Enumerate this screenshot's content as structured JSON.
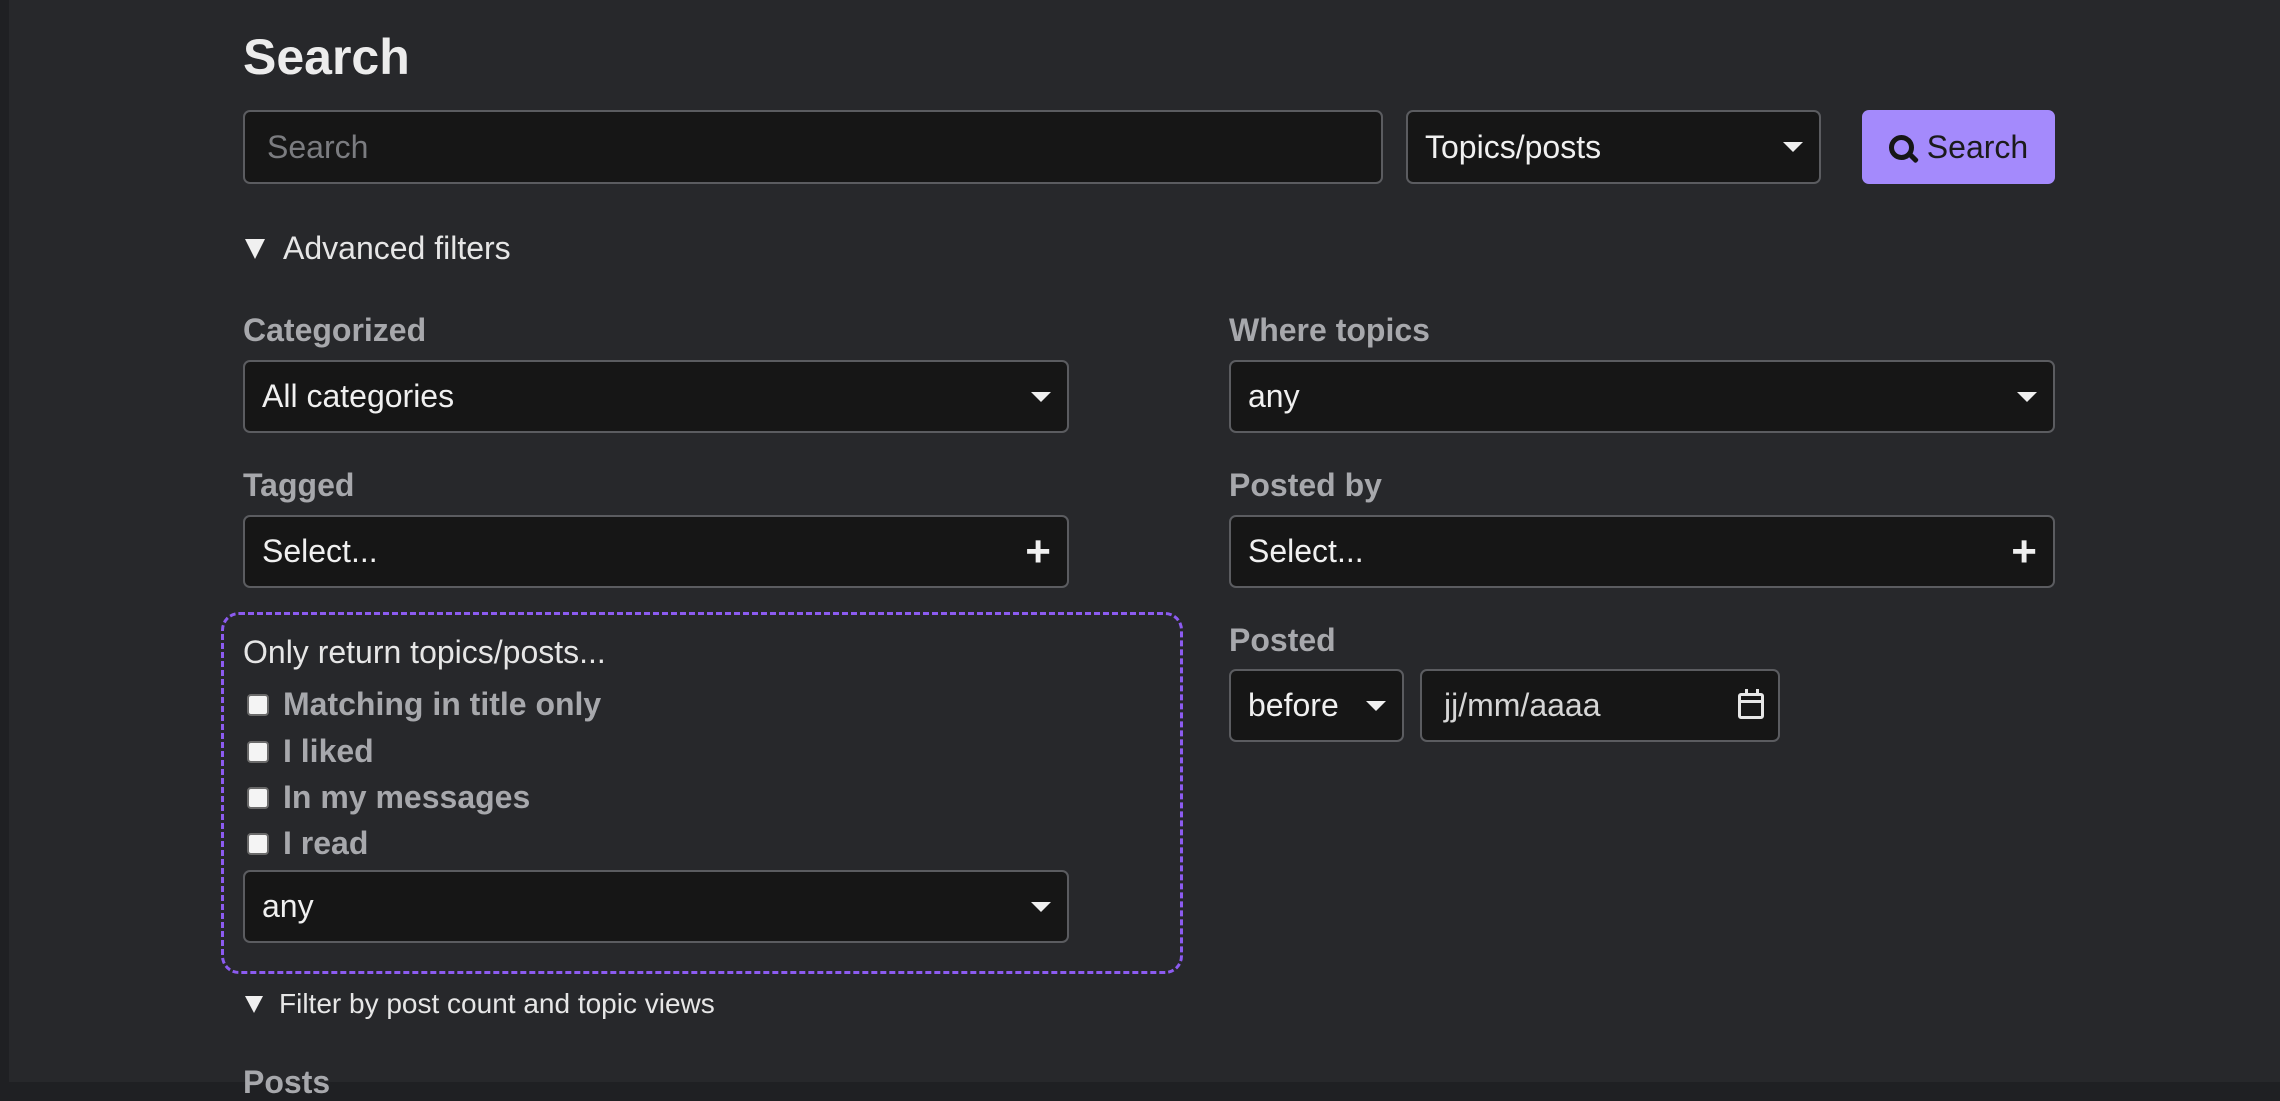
{
  "header": {
    "title": "Search"
  },
  "search": {
    "placeholder": "Search",
    "type_select": "Topics/posts",
    "button_label": "Search"
  },
  "advanced": {
    "toggle_label": "Advanced filters",
    "categorized": {
      "label": "Categorized",
      "value": "All categories"
    },
    "where_topics": {
      "label": "Where topics",
      "value": "any"
    },
    "tagged": {
      "label": "Tagged",
      "value": "Select..."
    },
    "posted_by": {
      "label": "Posted by",
      "value": "Select..."
    },
    "posted": {
      "label": "Posted",
      "when": "before",
      "date_placeholder": "jj/mm/aaaa"
    },
    "only_return": {
      "heading": "Only return topics/posts...",
      "options": [
        "Matching in title only",
        "I liked",
        "In my messages",
        "I read"
      ],
      "status_value": "any"
    },
    "post_count_toggle": "Filter by post count and topic views",
    "posts_label": "Posts"
  },
  "colors": {
    "accent": "#a48afc",
    "dashed_border": "#8c5bf0",
    "background": "#27282b"
  }
}
